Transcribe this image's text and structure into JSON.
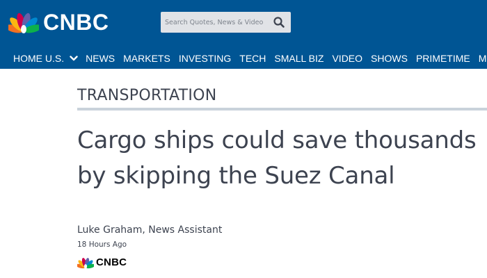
{
  "brand": {
    "name": "CNBC",
    "peacock_colors": [
      "#f37021",
      "#fcb711",
      "#cc004c",
      "#6460aa",
      "#0089d0",
      "#0db14b"
    ],
    "header_color": "#005594"
  },
  "search": {
    "placeholder": "Search Quotes, News & Video",
    "icon": "magnifier-icon"
  },
  "nav": {
    "items": [
      {
        "label": "HOME U.S.",
        "has_dropdown": true
      },
      {
        "label": "NEWS"
      },
      {
        "label": "MARKETS"
      },
      {
        "label": "INVESTING"
      },
      {
        "label": "TECH"
      },
      {
        "label": "SMALL BIZ"
      },
      {
        "label": "VIDEO"
      },
      {
        "label": "SHOWS"
      },
      {
        "label": "PRIMETIME"
      },
      {
        "label": "MORE"
      }
    ]
  },
  "article": {
    "section": "TRANSPORTATION",
    "headline": "Cargo ships could save thousands by skipping the Suez Canal",
    "byline": "Luke Graham, News Assistant",
    "timestamp": "18 Hours Ago",
    "source": "CNBC"
  }
}
